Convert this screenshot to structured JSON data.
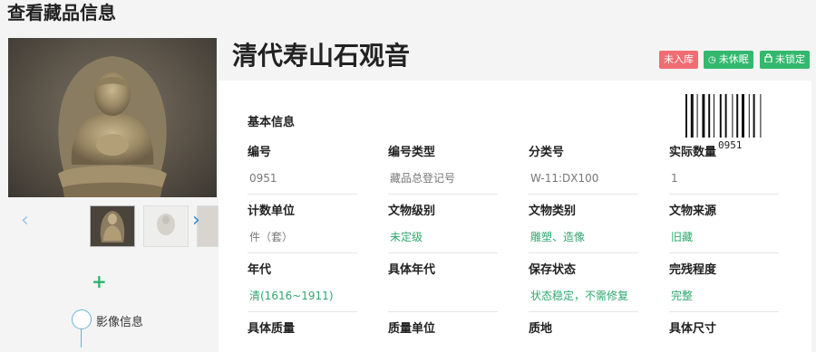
{
  "page_title": "查看藏品信息",
  "object_title": "清代寿山石观音",
  "badges": [
    {
      "text": "未入库",
      "color": "#f06d73"
    },
    {
      "text": "未休眠",
      "icon": "clock-icon",
      "color": "#33b86d"
    },
    {
      "text": "未锁定",
      "icon": "lock-icon",
      "color": "#33b86d"
    }
  ],
  "section_title": "基本信息",
  "barcode_number": "0951",
  "fields": [
    {
      "label": "编号",
      "value": "0951"
    },
    {
      "label": "编号类型",
      "value": "藏品总登记号"
    },
    {
      "label": "分类号",
      "value": "W-11:DX100"
    },
    {
      "label": "实际数量",
      "value": "1"
    },
    {
      "label": "计数单位",
      "value": "件（套）"
    },
    {
      "label": "文物级别",
      "value": "未定级"
    },
    {
      "label": "文物类别",
      "value": "雕塑、造像"
    },
    {
      "label": "文物来源",
      "value": "旧藏"
    },
    {
      "label": "年代",
      "value": "清(1616~1911)"
    },
    {
      "label": "具体年代",
      "value": ""
    },
    {
      "label": "保存状态",
      "value": "状态稳定，不需修复"
    },
    {
      "label": "完残程度",
      "value": "完整"
    },
    {
      "label": "具体质量",
      "value": ""
    },
    {
      "label": "质量单位",
      "value": ""
    },
    {
      "label": "质地",
      "value": ""
    },
    {
      "label": "具体尺寸",
      "value": ""
    }
  ],
  "timeline": {
    "label": "影像信息"
  },
  "icons": {
    "prev": "chevron-left-icon",
    "next": "chevron-right-icon",
    "add": "plus-icon"
  },
  "colors": {
    "accent_green": "#2fa86e",
    "badge_red": "#f06d73",
    "badge_green": "#33b86d",
    "timeline_blue": "#6bb2d9"
  }
}
